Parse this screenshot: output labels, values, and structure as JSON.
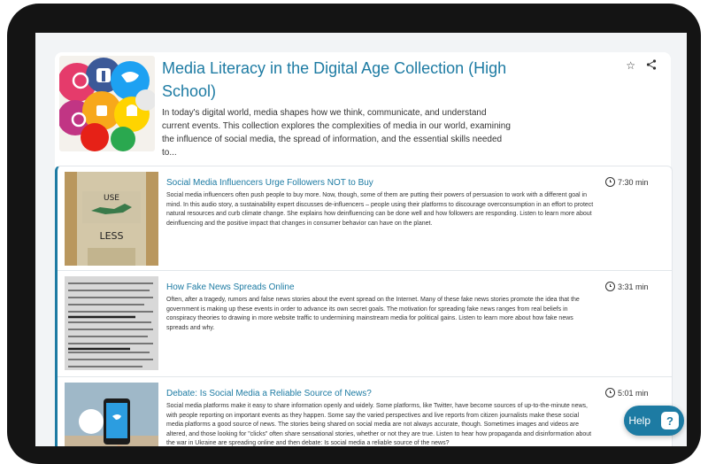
{
  "collection": {
    "title": "Media Literacy in the Digital Age Collection (High School)",
    "description": "In today's digital world, media shapes how we think, communicate, and understand current events. This collection explores the complexities of media in our world, examining the influence of social media, the spread of information, and the essential skills needed to...",
    "actions": {
      "favorite_icon": "star-icon",
      "share_icon": "share-icon"
    }
  },
  "items": [
    {
      "title": "Social Media Influencers Urge Followers NOT to Buy",
      "description": "Social media influencers often push people to buy more. Now, though, some of them are putting their powers of persuasion to work with a different goal in mind. In this audio story, a sustainability expert discusses de-influencers – people using their platforms to discourage overconsumption in an effort to protect natural resources and curb climate change. She explains how deinfluencing can be done well and how followers are responding. Listen to learn more about deinfluencing and the positive impact that changes in consumer behavior can have on the planet.",
      "duration": "7:30 min",
      "thumb_text_top": "USE",
      "thumb_text_bottom": "LESS"
    },
    {
      "title": "How Fake News Spreads Online",
      "description": "Often, after a tragedy, rumors and false news stories about the event spread on the Internet. Many of these fake news stories promote the idea that the government is making up these events in order to advance its own secret goals. The motivation for spreading fake news ranges from real beliefs in conspiracy theories to drawing in more website traffic to undermining mainstream media for political gains. Listen to learn more about how fake news spreads and why.",
      "duration": "3:31 min"
    },
    {
      "title": "Debate: Is Social Media a Reliable Source of News?",
      "description": "Social media platforms make it easy to share information openly and widely. Some platforms, like Twitter, have become sources of up-to-the-minute news, with people reporting on important events as they happen. Some say the varied perspectives and live reports from citizen journalists make these social media platforms a good source of news. The stories being shared on social media are not always accurate, though. Sometimes images and videos are altered, and those looking for \"clicks\" often share sensational stories, whether or not they are true. Listen to hear how propaganda and disinformation about the war in Ukraine are spreading online and then debate: Is social media a reliable source of the news?",
      "duration": "5:01 min"
    }
  ],
  "help": {
    "label": "Help",
    "icon": "help-chat-icon",
    "icon_glyph": "?"
  },
  "colors": {
    "accent": "#1d7ba3",
    "device_frame": "#141414"
  }
}
